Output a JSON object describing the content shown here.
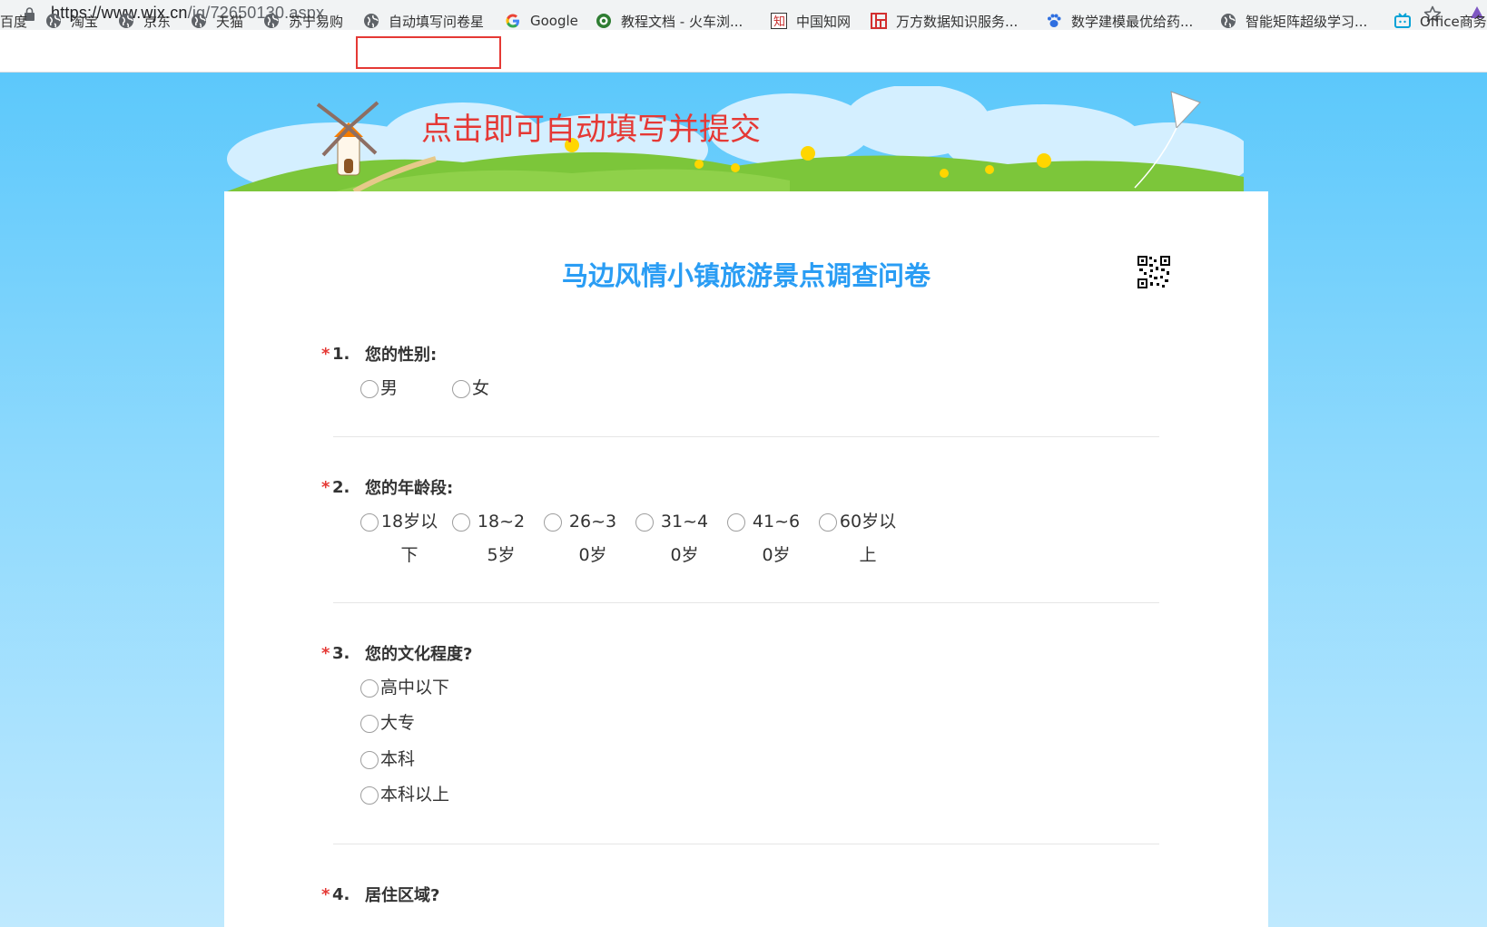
{
  "browser": {
    "url_main": "https://www.wjx.cn",
    "url_path": "/jq/72650130.aspx"
  },
  "bookmarks": [
    {
      "label": "百度",
      "icon": "none"
    },
    {
      "label": "淘宝",
      "icon": "globe-icon"
    },
    {
      "label": "京东",
      "icon": "globe-icon"
    },
    {
      "label": "天猫",
      "icon": "globe-icon"
    },
    {
      "label": "苏宁易购",
      "icon": "globe-icon"
    },
    {
      "label": "自动填写问卷星",
      "icon": "globe-icon"
    },
    {
      "label": "Google",
      "icon": "google-icon"
    },
    {
      "label": "教程文档 - 火车浏...",
      "icon": "locoy-icon"
    },
    {
      "label": "中国知网",
      "icon": "cnki-icon"
    },
    {
      "label": "万方数据知识服务...",
      "icon": "wanfang-icon"
    },
    {
      "label": "数学建模最优给药...",
      "icon": "paw-icon"
    },
    {
      "label": "智能矩阵超级学习...",
      "icon": "globe-icon"
    },
    {
      "label": "Office商务",
      "icon": "tv-icon"
    }
  ],
  "banner": {
    "caption": "点击即可自动填写并提交"
  },
  "survey": {
    "title": "马边风情小镇旅游景点调查问卷",
    "questions": [
      {
        "required": "*",
        "num": "1.",
        "text": "您的性别:",
        "options": [
          "男",
          "女"
        ]
      },
      {
        "required": "*",
        "num": "2.",
        "text": "您的年龄段:",
        "options": [
          "18岁以下",
          "18~25岁",
          "26~30岁",
          "31~40岁",
          "41~60岁",
          "60岁以上"
        ]
      },
      {
        "required": "*",
        "num": "3.",
        "text": "您的文化程度?",
        "options": [
          "高中以下",
          "大专",
          "本科",
          "本科以上"
        ]
      },
      {
        "required": "*",
        "num": "4.",
        "text": "居住区域?",
        "options": []
      }
    ]
  },
  "colors": {
    "title": "#2a9df4",
    "required": "#e53935",
    "caption": "#e53935",
    "sky_top": "#5cc8fb",
    "sky_bottom": "#bfe9fe"
  }
}
